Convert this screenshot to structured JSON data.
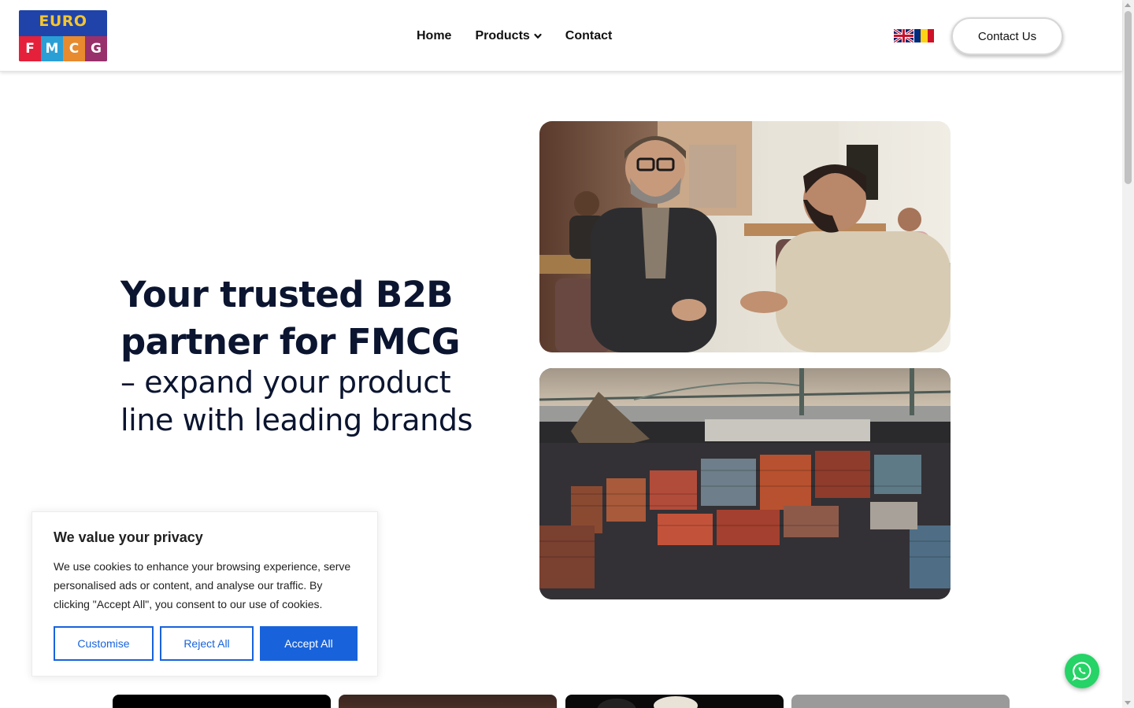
{
  "header": {
    "logo": {
      "top_text": "EURO",
      "tiles": [
        "F",
        "M",
        "C",
        "G"
      ]
    },
    "nav": [
      {
        "label": "Home"
      },
      {
        "label": "Products"
      },
      {
        "label": "Contact"
      }
    ],
    "languages": [
      "English",
      "Romanian"
    ],
    "contact_button": "Contact Us"
  },
  "hero": {
    "title": "Your trusted B2B partner for FMCG",
    "subtitle": "– expand your product line with leading brands",
    "images": [
      "business-meeting-photo",
      "container-port-photo"
    ]
  },
  "cookie_banner": {
    "title": "We value your privacy",
    "text": "We use cookies to enhance your browsing experience, serve personalised ads or content, and analyse our traffic. By clicking \"Accept All\", you consent to our use of cookies.",
    "customise": "Customise",
    "reject": "Reject All",
    "accept": "Accept All"
  },
  "colors": {
    "brand_blue": "#1f43a8",
    "accent_blue": "#1863dc",
    "heading": "#0b1530",
    "whatsapp": "#25d366"
  },
  "icons": [
    "chevron-down-icon",
    "whatsapp-icon",
    "uk-flag-icon",
    "romania-flag-icon"
  ]
}
